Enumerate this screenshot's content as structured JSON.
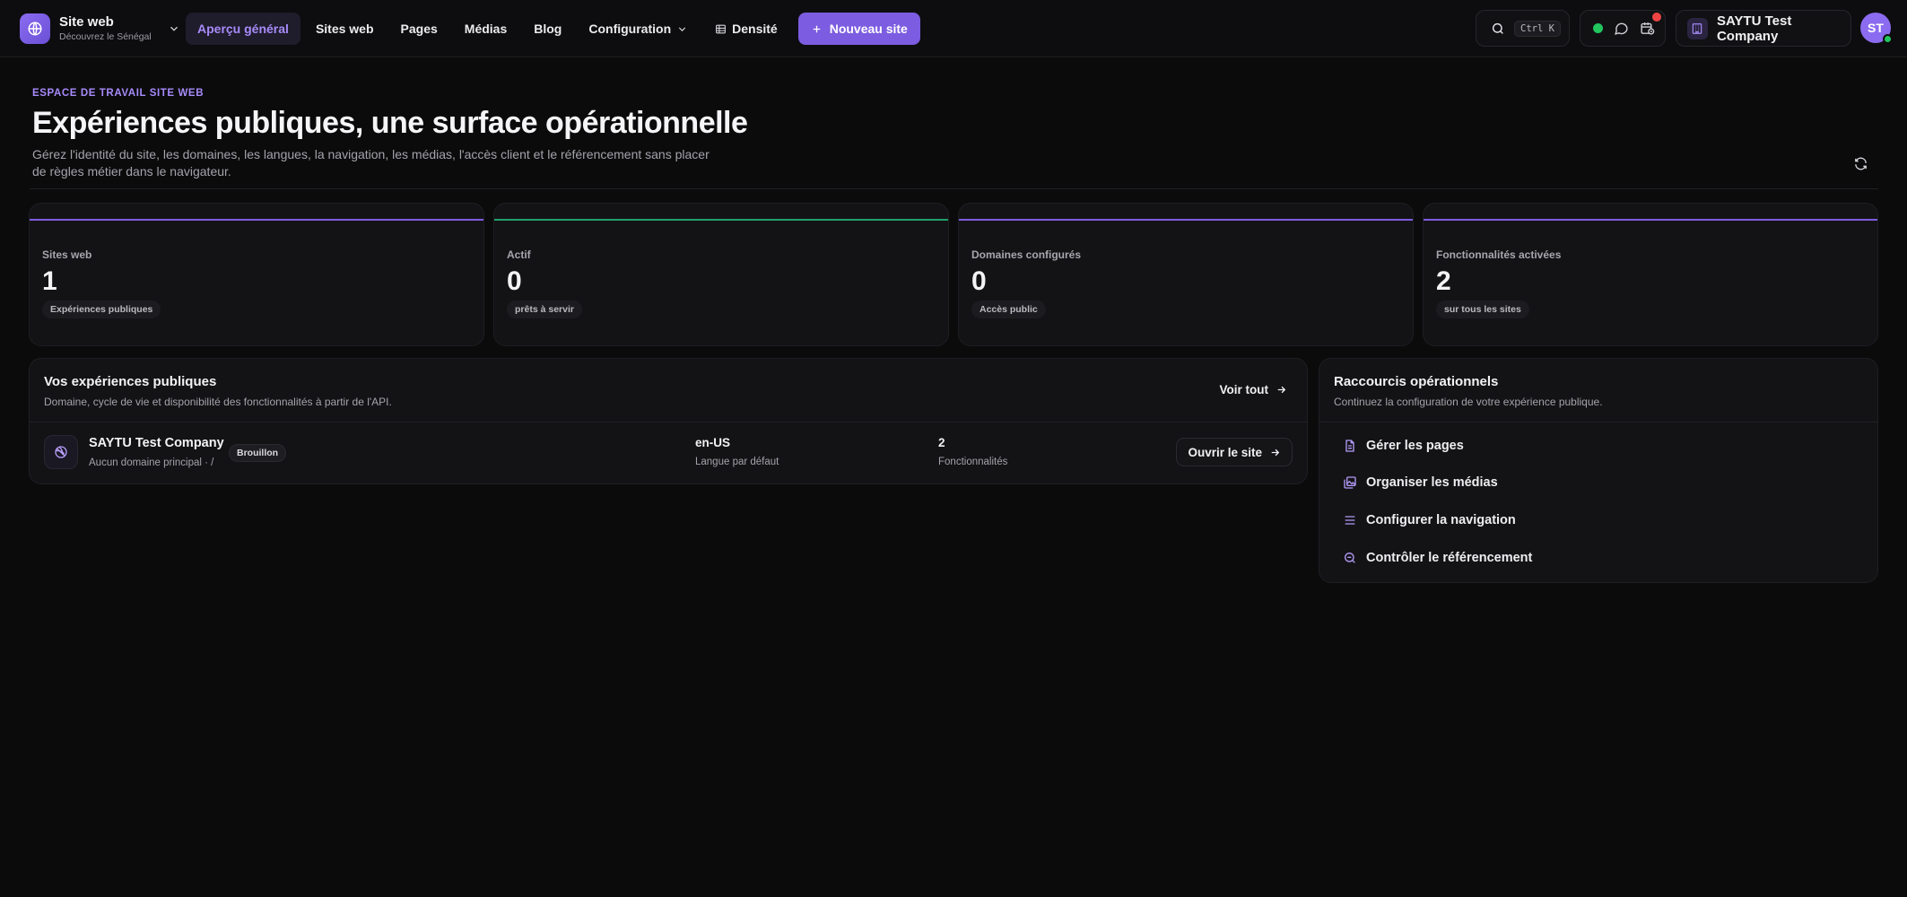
{
  "topbar": {
    "brand_title": "Site web",
    "brand_subtitle": "Découvrez le Sénégal",
    "nav": {
      "overview": "Aperçu général",
      "sites": "Sites web",
      "pages": "Pages",
      "media": "Médias",
      "blog": "Blog",
      "config": "Configuration",
      "density": "Densité"
    },
    "new_site": "Nouveau site",
    "search_shortcut": "Ctrl K",
    "company": "SAYTU Test Company",
    "avatar_initials": "ST"
  },
  "hero": {
    "eyebrow": "ESPACE DE TRAVAIL SITE WEB",
    "title": "Expériences publiques, une surface opérationnelle",
    "description": "Gérez l'identité du site, les domaines, les langues, la navigation, les médias, l'accès client et le référencement sans placer de règles métier dans le navigateur."
  },
  "stats": [
    {
      "label": "Sites web",
      "value": "1",
      "chip": "Expériences publiques",
      "accent": "#7c5ce0"
    },
    {
      "label": "Actif",
      "value": "0",
      "chip": "prêts à servir",
      "accent": "#22a06b"
    },
    {
      "label": "Domaines configurés",
      "value": "0",
      "chip": "Accès public",
      "accent": "#7c5ce0"
    },
    {
      "label": "Fonctionnalités activées",
      "value": "2",
      "chip": "sur tous les sites",
      "accent": "#7c5ce0"
    }
  ],
  "experiences": {
    "title": "Vos expériences publiques",
    "subtitle": "Domaine, cycle de vie et disponibilité des fonctionnalités à partir de l'API.",
    "see_all": "Voir tout",
    "site": {
      "name": "SAYTU Test Company",
      "meta": "Aucun domaine principal · /",
      "status": "Brouillon",
      "language": "en-US",
      "language_label": "Langue par défaut",
      "features": "2",
      "features_label": "Fonctionnalités",
      "open": "Ouvrir le site"
    }
  },
  "shortcuts": {
    "title": "Raccourcis opérationnels",
    "subtitle": "Continuez la configuration de votre expérience publique.",
    "items": [
      {
        "label": "Gérer les pages",
        "icon": "file-icon"
      },
      {
        "label": "Organiser les médias",
        "icon": "images-icon"
      },
      {
        "label": "Configurer la navigation",
        "icon": "menu-icon"
      },
      {
        "label": "Contrôler le référencement",
        "icon": "search-zoom-icon"
      }
    ]
  },
  "colors": {
    "accent": "#7c5ce0",
    "accent_text": "#a78bfa",
    "success": "#22c55e",
    "danger": "#ef4444",
    "background": "#0b0b0c"
  }
}
